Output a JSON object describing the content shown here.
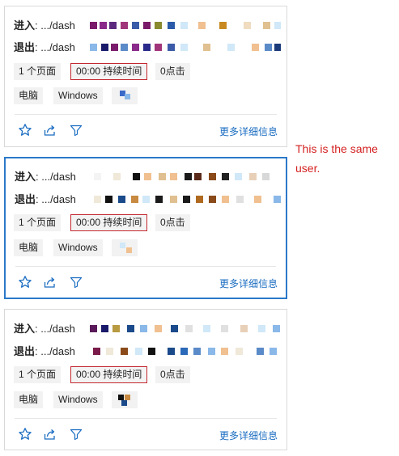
{
  "cards": [
    {
      "entry_label": "进入",
      "entry_url": ": .../dash",
      "exit_label": "退出",
      "exit_url": ": .../dash",
      "pages": "1 个页面",
      "duration": "00:00 持续时间",
      "clicks": "0点击",
      "device": "电脑",
      "os": "Windows",
      "more": "更多详细信息"
    },
    {
      "entry_label": "进入",
      "entry_url": ": .../dash",
      "exit_label": "退出",
      "exit_url": ": .../dash",
      "pages": "1 个页面",
      "duration": "00:00 持续时间",
      "clicks": "0点击",
      "device": "电脑",
      "os": "Windows",
      "more": "更多详细信息"
    },
    {
      "entry_label": "进入",
      "entry_url": ": .../dash",
      "exit_label": "退出",
      "exit_url": ": .../dash",
      "pages": "1 个页面",
      "duration": "00:00 持续时间",
      "clicks": "0点击",
      "device": "电脑",
      "os": "Windows",
      "more": "更多详细信息"
    }
  ],
  "annotation": {
    "text": "This is the same user."
  },
  "colors": {
    "selected_border": "#2b78c8",
    "highlight_box": "#c2262e",
    "link": "#1b6dc1",
    "annotation": "#d42121"
  },
  "icons": [
    "star-icon",
    "share-icon",
    "filter-icon"
  ]
}
